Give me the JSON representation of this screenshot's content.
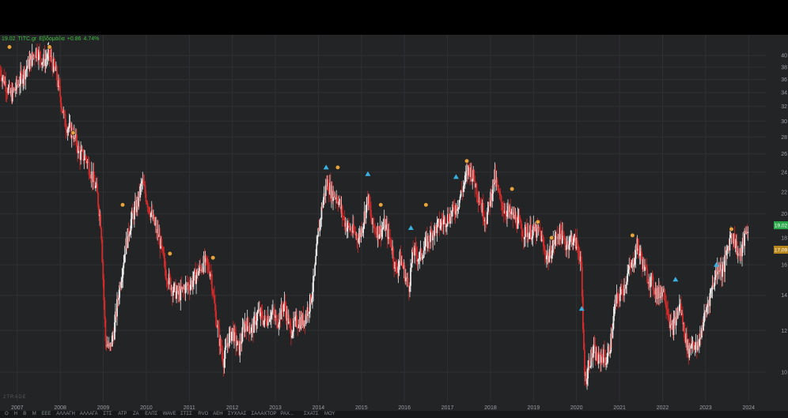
{
  "header": {
    "price": "19.02",
    "symbol": "TITC.gr",
    "interval": "Εβδομάδα",
    "change": "+0.86",
    "change_pct": "4.74%"
  },
  "watermark": "2TRADE",
  "colors": {
    "background": "#232426",
    "grid": "#2e3033",
    "up_candle": "#e8e8e8",
    "down_candle": "#d42a2a",
    "header_text": "#3fbf3f",
    "axis_text": "#9a9ea3",
    "last_price_tag": "#2aa84a",
    "secondary_tag": "#b8861b",
    "signal_orange": "#e6a23c",
    "signal_cyan": "#3ab0e0"
  },
  "price_tags": [
    {
      "value": "19,02",
      "color": "#2aa84a"
    },
    {
      "value": "17,09",
      "color": "#b8861b"
    }
  ],
  "bottom_toolbar": [
    "Ο",
    "Η",
    "Β",
    "Μ",
    "ΕΕΕ",
    "ΑΛΛΑΓΗ",
    "ΑΛΛΑΓΑ",
    "ΣΤΣ",
    "ΑΤΡ",
    "ΖΑ",
    "ΕΛΠΣ",
    "WAVE",
    "ΣΤΣΣ",
    "RVO",
    "ΑΕΗ",
    "ΣΥΧΛΑΣ",
    "ΣΑΛΑΧΤΟΡ",
    "ΡΑΧ...",
    "ΣΧΑΤΣ",
    "ΜΟΥ"
  ],
  "chart_data": {
    "type": "candlestick",
    "title": "",
    "xlabel": "",
    "ylabel": "",
    "interval": "weekly",
    "y_scale": "log",
    "ylim": [
      8.8,
      42
    ],
    "xlim": [
      2006.6,
      2024.4
    ],
    "grid": true,
    "y_ticks": [
      10,
      12,
      14,
      16,
      18,
      20,
      22,
      24,
      26,
      28,
      30,
      32,
      34,
      36,
      38,
      40
    ],
    "x_ticks": [
      "2007",
      "2008",
      "2009",
      "2010",
      "2011",
      "2012",
      "2013",
      "2014",
      "2015",
      "2016",
      "2017",
      "2018",
      "2019",
      "2020",
      "2021",
      "2022",
      "2023",
      "2024"
    ],
    "x_tick_years": [
      2007,
      2008,
      2009,
      2010,
      2011,
      2012,
      2013,
      2014,
      2015,
      2016,
      2017,
      2018,
      2019,
      2020,
      2021,
      2022,
      2023,
      2024
    ],
    "series": [
      {
        "close_path": [
          [
            2006.6,
            37.5
          ],
          [
            2006.75,
            35.0
          ],
          [
            2006.85,
            33.5
          ],
          [
            2006.95,
            34.5
          ],
          [
            2007.15,
            37.0
          ],
          [
            2007.3,
            39.0
          ],
          [
            2007.45,
            41.0
          ],
          [
            2007.6,
            39.0
          ],
          [
            2007.75,
            40.0
          ],
          [
            2007.9,
            37.0
          ],
          [
            2008.0,
            33.5
          ],
          [
            2008.1,
            30.0
          ],
          [
            2008.2,
            29.0
          ],
          [
            2008.3,
            28.5
          ],
          [
            2008.45,
            26.0
          ],
          [
            2008.6,
            25.5
          ],
          [
            2008.75,
            23.5
          ],
          [
            2008.85,
            22.0
          ],
          [
            2008.95,
            19.0
          ],
          [
            2009.05,
            11.5
          ],
          [
            2009.15,
            11.0
          ],
          [
            2009.25,
            12.0
          ],
          [
            2009.35,
            14.0
          ],
          [
            2009.5,
            17.0
          ],
          [
            2009.65,
            19.5
          ],
          [
            2009.8,
            21.0
          ],
          [
            2009.9,
            23.0
          ],
          [
            2010.0,
            21.5
          ],
          [
            2010.15,
            19.5
          ],
          [
            2010.3,
            18.0
          ],
          [
            2010.45,
            15.5
          ],
          [
            2010.6,
            14.5
          ],
          [
            2010.75,
            14.0
          ],
          [
            2010.9,
            14.5
          ],
          [
            2011.05,
            14.8
          ],
          [
            2011.2,
            15.5
          ],
          [
            2011.35,
            16.2
          ],
          [
            2011.5,
            15.5
          ],
          [
            2011.6,
            13.0
          ],
          [
            2011.7,
            11.5
          ],
          [
            2011.8,
            10.5
          ],
          [
            2011.9,
            11.5
          ],
          [
            2012.0,
            12.0
          ],
          [
            2012.15,
            11.0
          ],
          [
            2012.3,
            12.5
          ],
          [
            2012.45,
            12.0
          ],
          [
            2012.6,
            13.0
          ],
          [
            2012.75,
            12.5
          ],
          [
            2012.9,
            13.0
          ],
          [
            2013.05,
            12.5
          ],
          [
            2013.2,
            13.5
          ],
          [
            2013.35,
            12.0
          ],
          [
            2013.5,
            12.5
          ],
          [
            2013.65,
            12.5
          ],
          [
            2013.8,
            13.5
          ],
          [
            2013.9,
            15.0
          ],
          [
            2014.0,
            18.5
          ],
          [
            2014.1,
            21.0
          ],
          [
            2014.2,
            23.0
          ],
          [
            2014.3,
            22.0
          ],
          [
            2014.45,
            21.5
          ],
          [
            2014.55,
            20.0
          ],
          [
            2014.65,
            19.0
          ],
          [
            2014.8,
            18.5
          ],
          [
            2014.95,
            18.0
          ],
          [
            2015.05,
            19.5
          ],
          [
            2015.15,
            21.5
          ],
          [
            2015.25,
            19.0
          ],
          [
            2015.4,
            18.5
          ],
          [
            2015.55,
            19.0
          ],
          [
            2015.7,
            17.5
          ],
          [
            2015.8,
            15.5
          ],
          [
            2015.9,
            16.5
          ],
          [
            2016.0,
            15.5
          ],
          [
            2016.1,
            14.5
          ],
          [
            2016.2,
            17.0
          ],
          [
            2016.35,
            16.5
          ],
          [
            2016.5,
            17.5
          ],
          [
            2016.65,
            18.5
          ],
          [
            2016.8,
            19.0
          ],
          [
            2016.95,
            19.5
          ],
          [
            2017.1,
            20.0
          ],
          [
            2017.25,
            21.0
          ],
          [
            2017.4,
            23.0
          ],
          [
            2017.5,
            24.5
          ],
          [
            2017.6,
            23.5
          ],
          [
            2017.7,
            22.0
          ],
          [
            2017.8,
            20.5
          ],
          [
            2017.9,
            19.5
          ],
          [
            2018.0,
            21.5
          ],
          [
            2018.1,
            23.5
          ],
          [
            2018.2,
            21.5
          ],
          [
            2018.3,
            20.5
          ],
          [
            2018.45,
            20.0
          ],
          [
            2018.6,
            19.5
          ],
          [
            2018.75,
            18.5
          ],
          [
            2018.9,
            18.5
          ],
          [
            2019.05,
            18.5
          ],
          [
            2019.15,
            18.5
          ],
          [
            2019.25,
            17.0
          ],
          [
            2019.35,
            16.5
          ],
          [
            2019.45,
            17.5
          ],
          [
            2019.6,
            18.5
          ],
          [
            2019.75,
            17.5
          ],
          [
            2019.9,
            18.0
          ],
          [
            2020.0,
            17.5
          ],
          [
            2020.1,
            16.5
          ],
          [
            2020.15,
            12.0
          ],
          [
            2020.2,
            9.6
          ],
          [
            2020.3,
            10.5
          ],
          [
            2020.4,
            11.0
          ],
          [
            2020.5,
            10.5
          ],
          [
            2020.6,
            10.8
          ],
          [
            2020.7,
            10.5
          ],
          [
            2020.8,
            11.5
          ],
          [
            2020.9,
            13.5
          ],
          [
            2021.0,
            14.0
          ],
          [
            2021.1,
            14.5
          ],
          [
            2021.2,
            15.5
          ],
          [
            2021.3,
            16.0
          ],
          [
            2021.4,
            17.5
          ],
          [
            2021.5,
            16.5
          ],
          [
            2021.6,
            15.5
          ],
          [
            2021.7,
            15.0
          ],
          [
            2021.8,
            14.5
          ],
          [
            2021.9,
            14.0
          ],
          [
            2022.0,
            14.5
          ],
          [
            2022.1,
            13.5
          ],
          [
            2022.2,
            12.0
          ],
          [
            2022.3,
            12.5
          ],
          [
            2022.4,
            13.5
          ],
          [
            2022.5,
            12.0
          ],
          [
            2022.6,
            11.0
          ],
          [
            2022.7,
            11.5
          ],
          [
            2022.8,
            11.0
          ],
          [
            2022.9,
            12.0
          ],
          [
            2023.0,
            13.0
          ],
          [
            2023.1,
            14.0
          ],
          [
            2023.2,
            15.0
          ],
          [
            2023.3,
            16.0
          ],
          [
            2023.4,
            15.5
          ],
          [
            2023.5,
            17.0
          ],
          [
            2023.6,
            18.5
          ],
          [
            2023.7,
            17.5
          ],
          [
            2023.8,
            16.5
          ],
          [
            2023.9,
            18.0
          ],
          [
            2024.0,
            19.02
          ]
        ]
      }
    ],
    "signals": [
      {
        "x": 2006.82,
        "y": 41.5,
        "kind": "orange"
      },
      {
        "x": 2007.75,
        "y": 41.5,
        "kind": "orange"
      },
      {
        "x": 2008.3,
        "y": 28.5,
        "kind": "orange"
      },
      {
        "x": 2009.45,
        "y": 20.8,
        "kind": "orange"
      },
      {
        "x": 2010.55,
        "y": 16.8,
        "kind": "orange"
      },
      {
        "x": 2011.55,
        "y": 16.5,
        "kind": "orange"
      },
      {
        "x": 2014.18,
        "y": 24.5,
        "kind": "cyan"
      },
      {
        "x": 2014.45,
        "y": 24.5,
        "kind": "orange"
      },
      {
        "x": 2015.15,
        "y": 23.8,
        "kind": "cyan"
      },
      {
        "x": 2015.45,
        "y": 20.8,
        "kind": "orange"
      },
      {
        "x": 2016.15,
        "y": 18.8,
        "kind": "cyan"
      },
      {
        "x": 2016.5,
        "y": 20.8,
        "kind": "orange"
      },
      {
        "x": 2017.2,
        "y": 23.5,
        "kind": "cyan"
      },
      {
        "x": 2017.45,
        "y": 25.2,
        "kind": "orange"
      },
      {
        "x": 2018.5,
        "y": 22.3,
        "kind": "orange"
      },
      {
        "x": 2019.1,
        "y": 19.3,
        "kind": "orange"
      },
      {
        "x": 2019.42,
        "y": 18.0,
        "kind": "orange"
      },
      {
        "x": 2020.12,
        "y": 13.2,
        "kind": "cyan"
      },
      {
        "x": 2021.3,
        "y": 18.2,
        "kind": "orange"
      },
      {
        "x": 2022.3,
        "y": 15.0,
        "kind": "cyan"
      },
      {
        "x": 2023.25,
        "y": 16.0,
        "kind": "cyan"
      },
      {
        "x": 2023.6,
        "y": 18.7,
        "kind": "orange"
      }
    ]
  }
}
